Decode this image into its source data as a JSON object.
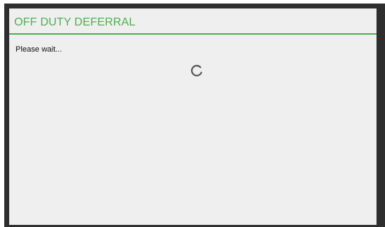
{
  "dialog": {
    "title": "OFF DUTY DEFERRAL",
    "message": "Please wait...",
    "spinner_icon": "loading-spinner-icon"
  },
  "colors": {
    "accent": "#4caf50",
    "frame": "#2e2e2e",
    "dialog_background": "#efefef",
    "text": "#111111",
    "spinner": "#555555"
  }
}
